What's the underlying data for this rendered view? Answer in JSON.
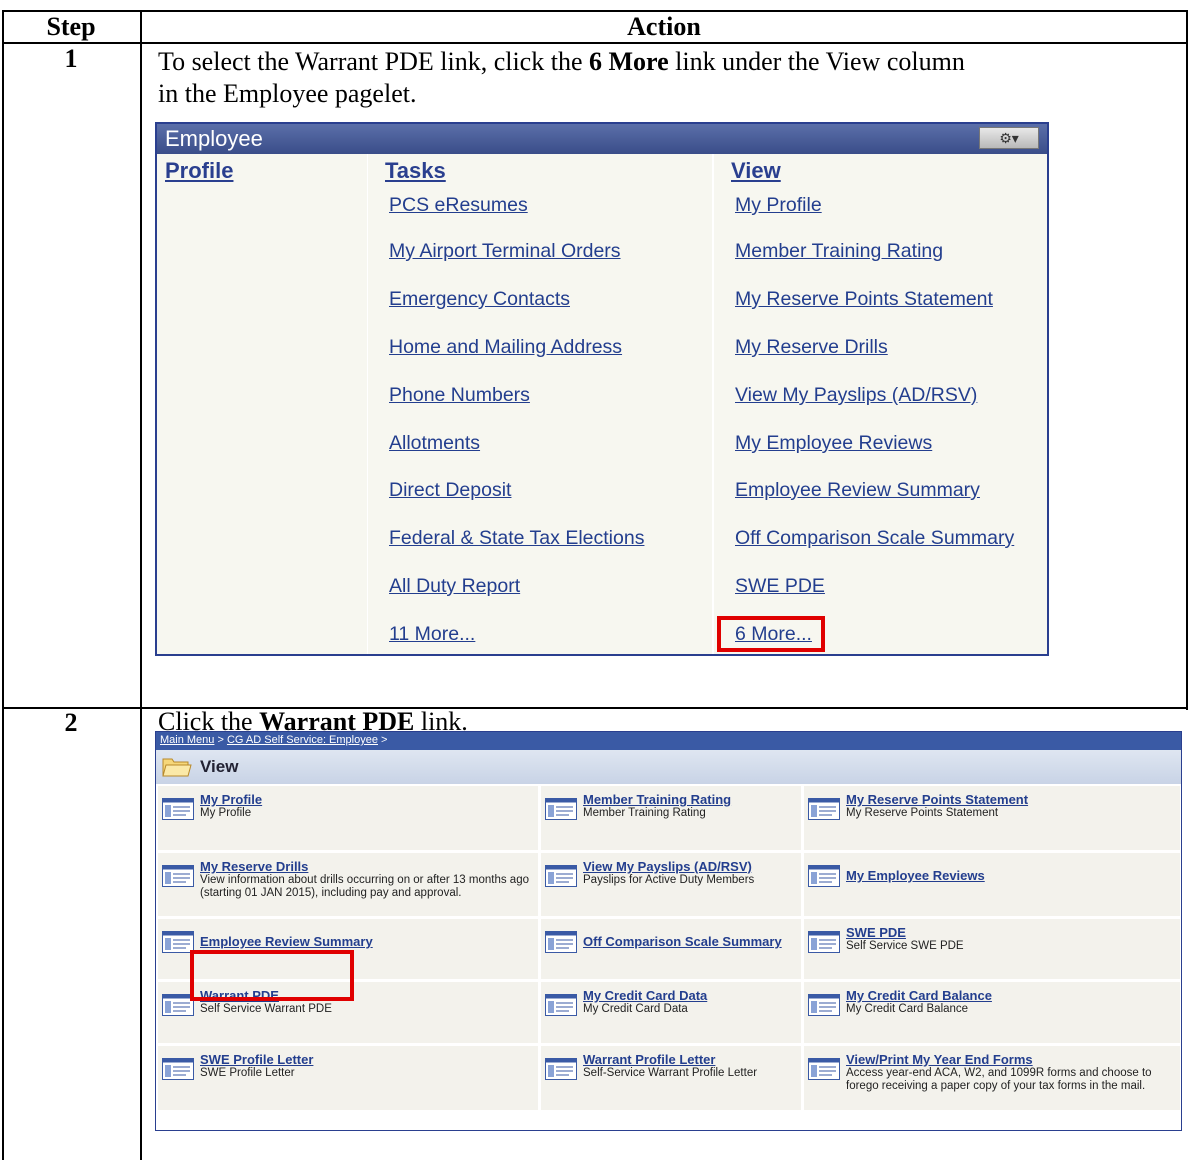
{
  "table": {
    "header_step": "Step",
    "header_action": "Action"
  },
  "step1": {
    "number": "1",
    "instr_pre": "To select the Warrant PDE link, click the ",
    "instr_bold": "6 More",
    "instr_post": " link under the View column",
    "instr_line2": "in the Employee pagelet."
  },
  "pagelet": {
    "title": "Employee",
    "gear": "⚙▾",
    "col_profile": "Profile",
    "col_tasks": "Tasks",
    "col_view": "View",
    "tasks": [
      "PCS eResumes",
      "My Airport Terminal Orders",
      "Emergency Contacts",
      "Home and Mailing Address",
      "Phone Numbers",
      "Allotments",
      "Direct Deposit",
      "Federal & State Tax Elections",
      "All Duty Report",
      "11 More..."
    ],
    "view": [
      "My Profile",
      "Member Training Rating",
      "My Reserve Points Statement",
      "My Reserve Drills",
      "View My Payslips (AD/RSV)",
      "My Employee Reviews",
      "Employee Review Summary",
      "Off Comparison Scale Summary",
      "SWE PDE",
      "6 More..."
    ]
  },
  "step2": {
    "number": "2",
    "instr_pre": "Click the ",
    "instr_bold": "Warrant PDE",
    "instr_post": " link."
  },
  "panel2": {
    "crumb_main": "Main Menu",
    "crumb_sep1": " > ",
    "crumb_cg": "CG AD Self Service: Employee",
    "crumb_sep2": " >",
    "view_title": "View",
    "cells": [
      {
        "title": "My Profile",
        "desc": "My Profile"
      },
      {
        "title": "Member Training Rating",
        "desc": "Member Training Rating"
      },
      {
        "title": "My Reserve Points Statement",
        "desc": "My Reserve Points Statement"
      },
      {
        "title": "My Reserve Drills",
        "desc": "View information about drills occurring on or after 13 months ago (starting 01 JAN 2015), including pay and approval."
      },
      {
        "title": "View My Payslips (AD/RSV)",
        "desc": "Payslips for Active Duty Members"
      },
      {
        "title": "My Employee Reviews",
        "desc": ""
      },
      {
        "title": "Employee Review Summary",
        "desc": ""
      },
      {
        "title": "Off Comparison Scale Summary",
        "desc": ""
      },
      {
        "title": "SWE PDE",
        "desc": "Self Service SWE PDE"
      },
      {
        "title": "Warrant PDE",
        "desc": "Self Service Warrant PDE"
      },
      {
        "title": "My Credit Card Data",
        "desc": "My Credit Card Data"
      },
      {
        "title": "My Credit Card Balance",
        "desc": "My Credit Card Balance"
      },
      {
        "title": "SWE Profile Letter",
        "desc": "SWE Profile Letter"
      },
      {
        "title": "Warrant Profile Letter",
        "desc": "Self-Service Warrant Profile Letter"
      },
      {
        "title": "View/Print My Year End Forms",
        "desc": "Access year-end ACA, W2, and 1099R forms and choose to forego receiving a paper copy of your tax forms in the mail."
      }
    ]
  }
}
